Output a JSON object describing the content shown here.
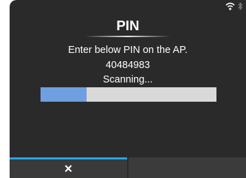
{
  "screen": {
    "title": "PIN",
    "instruction": "Enter below PIN on the AP.",
    "pin_code": "40484983",
    "status_text": "Scanning...",
    "progress_fraction": 0.26
  },
  "status_icons": [
    "wifi-icon",
    "bluetooth-icon"
  ],
  "softkeys": [
    {
      "icon": "close-icon",
      "glyph": "×",
      "active": true
    },
    {
      "icon": "",
      "glyph": "",
      "active": false
    }
  ],
  "colors": {
    "background": "#2a2a2a",
    "progress_fill": "#6f9fe0",
    "progress_track": "#d9d9d9",
    "softkey_accent": "#27a7e7",
    "text": "#ffffff"
  }
}
